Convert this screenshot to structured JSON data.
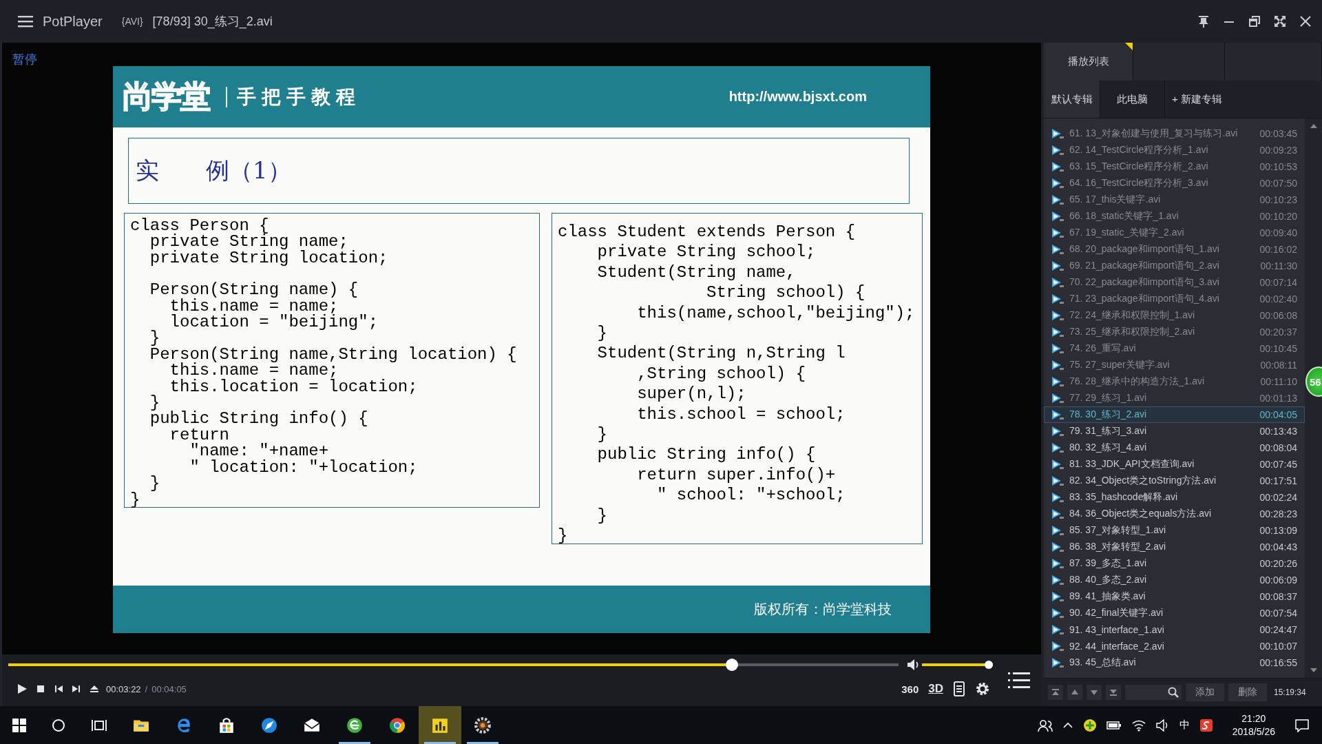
{
  "title_bar": {
    "app_name": "PotPlayer",
    "format": "{AVI}",
    "file": "[78/93] 30_练习_2.avi"
  },
  "video": {
    "status": "暂停",
    "slide": {
      "logo": "尚学堂",
      "tagline": "手把手教程",
      "url": "http://www.bjsxt.com",
      "heading": "实　　例（1）",
      "code_blocks": [
        {
          "groups": [
            [
              "class Person {",
              "  private String name;",
              "  private String location;"
            ],
            [
              "  Person(String name) {",
              "    this.name = name;",
              "    location = \"beijing\";",
              "  }",
              "  Person(String name,String location) {",
              "    this.name = name;",
              "    this.location = location;",
              "  }",
              "  public String info() {",
              "    return",
              "      \"name: \"+name+",
              "      \" location: \"+location;",
              "  }",
              "}"
            ]
          ]
        },
        {
          "groups": [
            [
              "class Student extends Person {",
              "    private String school;",
              "    Student(String name,",
              "               String school) {",
              "        this(name,school,\"beijing\");",
              "    }",
              "    Student(String n,String l",
              "        ,String school) {",
              "        super(n,l);",
              "        this.school = school;",
              "    }",
              "    public String info() {",
              "        return super.info()+",
              "          \" school: \"+school;",
              "    }",
              "}"
            ]
          ]
        }
      ],
      "footer": "版权所有：尚学堂科技"
    }
  },
  "controls": {
    "progress": {
      "level": 0.817
    },
    "volume": {
      "level": 1.0
    },
    "elapsed": "00:03:22",
    "separator": "/",
    "total": "00:04:05",
    "vr_label": "360",
    "three_d_label": "3D"
  },
  "playlist": {
    "tabs": [
      {
        "label": "播放列表",
        "selected": true
      }
    ],
    "albums": [
      {
        "label": "默认专辑",
        "selected": true
      },
      {
        "label": "此电脑",
        "selected": false
      },
      {
        "label": "+ 新建专辑",
        "selected": false
      }
    ],
    "items": [
      {
        "title": "61. 13_对象创建与使用_复习与练习.avi",
        "duration": "00:03:45",
        "played": true,
        "selected": false
      },
      {
        "title": "62. 14_TestCircle程序分析_1.avi",
        "duration": "00:09:23",
        "played": true,
        "selected": false
      },
      {
        "title": "63. 15_TestCircle程序分析_2.avi",
        "duration": "00:10:53",
        "played": true,
        "selected": false
      },
      {
        "title": "64. 16_TestCircle程序分析_3.avi",
        "duration": "00:07:50",
        "played": true,
        "selected": false
      },
      {
        "title": "65. 17_this关键字.avi",
        "duration": "00:10:23",
        "played": true,
        "selected": false
      },
      {
        "title": "66. 18_static关键字_1.avi",
        "duration": "00:10:20",
        "played": true,
        "selected": false
      },
      {
        "title": "67. 19_static_关键字_2.avi",
        "duration": "00:09:40",
        "played": true,
        "selected": false
      },
      {
        "title": "68. 20_package和import语句_1.avi",
        "duration": "00:16:02",
        "played": true,
        "selected": false
      },
      {
        "title": "69. 21_package和import语句_2.avi",
        "duration": "00:11:30",
        "played": true,
        "selected": false
      },
      {
        "title": "70. 22_package和import语句_3.avi",
        "duration": "00:07:14",
        "played": true,
        "selected": false
      },
      {
        "title": "71. 23_package和import语句_4.avi",
        "duration": "00:02:40",
        "played": true,
        "selected": false
      },
      {
        "title": "72. 24_继承和权限控制_1.avi",
        "duration": "00:06:08",
        "played": true,
        "selected": false
      },
      {
        "title": "73. 25_继承和权限控制_2.avi",
        "duration": "00:20:37",
        "played": true,
        "selected": false
      },
      {
        "title": "74. 26_重写.avi",
        "duration": "00:10:45",
        "played": true,
        "selected": false
      },
      {
        "title": "75. 27_super关键字.avi",
        "duration": "00:08:11",
        "played": true,
        "selected": false
      },
      {
        "title": "76. 28_继承中的构造方法_1.avi",
        "duration": "00:11:10",
        "played": true,
        "selected": false
      },
      {
        "title": "77. 29_练习_1.avi",
        "duration": "00:01:13",
        "played": true,
        "selected": false
      },
      {
        "title": "78. 30_练习_2.avi",
        "duration": "00:04:05",
        "played": false,
        "selected": true
      },
      {
        "title": "79. 31_练习_3.avi",
        "duration": "00:13:43",
        "played": false,
        "selected": false
      },
      {
        "title": "80. 32_练习_4.avi",
        "duration": "00:08:04",
        "played": false,
        "selected": false
      },
      {
        "title": "81. 33_JDK_API文档查询.avi",
        "duration": "00:07:45",
        "played": false,
        "selected": false
      },
      {
        "title": "82. 34_Object类之toString方法.avi",
        "duration": "00:17:51",
        "played": false,
        "selected": false
      },
      {
        "title": "83. 35_hashcode解释.avi",
        "duration": "00:02:24",
        "played": false,
        "selected": false
      },
      {
        "title": "84. 36_Object类之equals方法.avi",
        "duration": "00:28:23",
        "played": false,
        "selected": false
      },
      {
        "title": "85. 37_对象转型_1.avi",
        "duration": "00:13:09",
        "played": false,
        "selected": false
      },
      {
        "title": "86. 38_对象转型_2.avi",
        "duration": "00:04:43",
        "played": false,
        "selected": false
      },
      {
        "title": "87. 39_多态_1.avi",
        "duration": "00:20:26",
        "played": false,
        "selected": false
      },
      {
        "title": "88. 40_多态_2.avi",
        "duration": "00:06:09",
        "played": false,
        "selected": false
      },
      {
        "title": "89. 41_抽象类.avi",
        "duration": "00:08:37",
        "played": false,
        "selected": false
      },
      {
        "title": "90. 42_final关键字.avi",
        "duration": "00:07:54",
        "played": false,
        "selected": false
      },
      {
        "title": "91. 43_interface_1.avi",
        "duration": "00:24:47",
        "played": false,
        "selected": false
      },
      {
        "title": "92. 44_interface_2.avi",
        "duration": "00:10:07",
        "played": false,
        "selected": false
      },
      {
        "title": "93. 45_总结.avi",
        "duration": "00:16:55",
        "played": false,
        "selected": false
      }
    ],
    "buttons": [
      "添加",
      "删除"
    ],
    "clock": "15:19:34",
    "badge": "56"
  },
  "taskbar": {
    "apps": [
      {
        "running": false,
        "active": false
      },
      {
        "running": false,
        "active": false
      },
      {
        "running": false,
        "active": false
      },
      {
        "running": false,
        "active": false
      },
      {
        "running": false,
        "active": false
      },
      {
        "running": true,
        "active": false
      },
      {
        "running": false,
        "active": false
      },
      {
        "running": true,
        "active": true
      },
      {
        "running": true,
        "active": false
      }
    ],
    "ime": "中",
    "time": "21:20",
    "date": "2018/5/26"
  }
}
